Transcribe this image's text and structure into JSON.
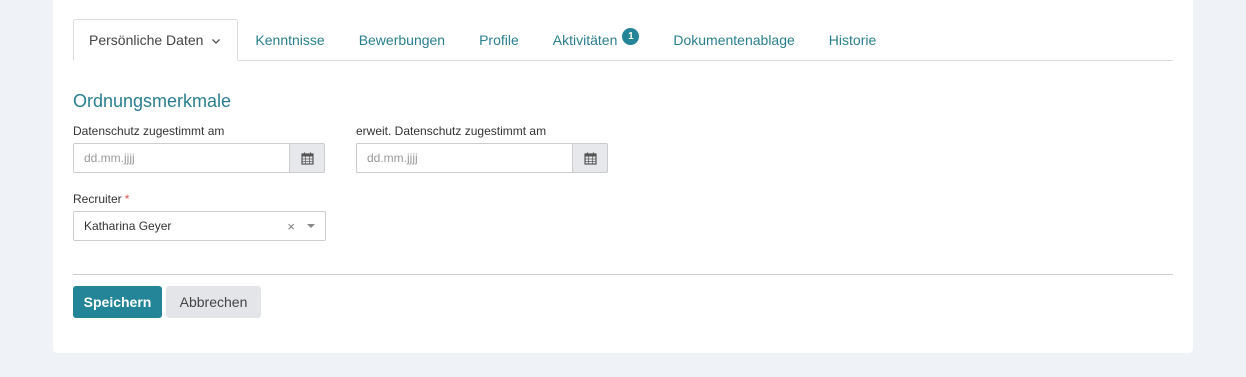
{
  "tabs": [
    {
      "label": "Persönliche Daten",
      "active": true
    },
    {
      "label": "Kenntnisse"
    },
    {
      "label": "Bewerbungen"
    },
    {
      "label": "Profile"
    },
    {
      "label": "Aktivitäten",
      "badge": "1"
    },
    {
      "label": "Dokumentenablage"
    },
    {
      "label": "Historie"
    }
  ],
  "section": {
    "title": "Ordnungsmerkmale"
  },
  "fields": {
    "privacy_date": {
      "label": "Datenschutz zugestimmt am",
      "placeholder": "dd.mm.jjjj",
      "value": ""
    },
    "ext_privacy_date": {
      "label": "erweit. Datenschutz zugestimmt am",
      "placeholder": "dd.mm.jjjj",
      "value": ""
    },
    "recruiter": {
      "label": "Recruiter",
      "required_mark": "*",
      "value": "Katharina Geyer",
      "clear_symbol": "×"
    }
  },
  "actions": {
    "save_label": "Speichern",
    "cancel_label": "Abbrechen"
  },
  "colors": {
    "accent": "#238597",
    "link": "#2a7f8f",
    "background": "#eff2f6",
    "required": "#d9534f"
  }
}
